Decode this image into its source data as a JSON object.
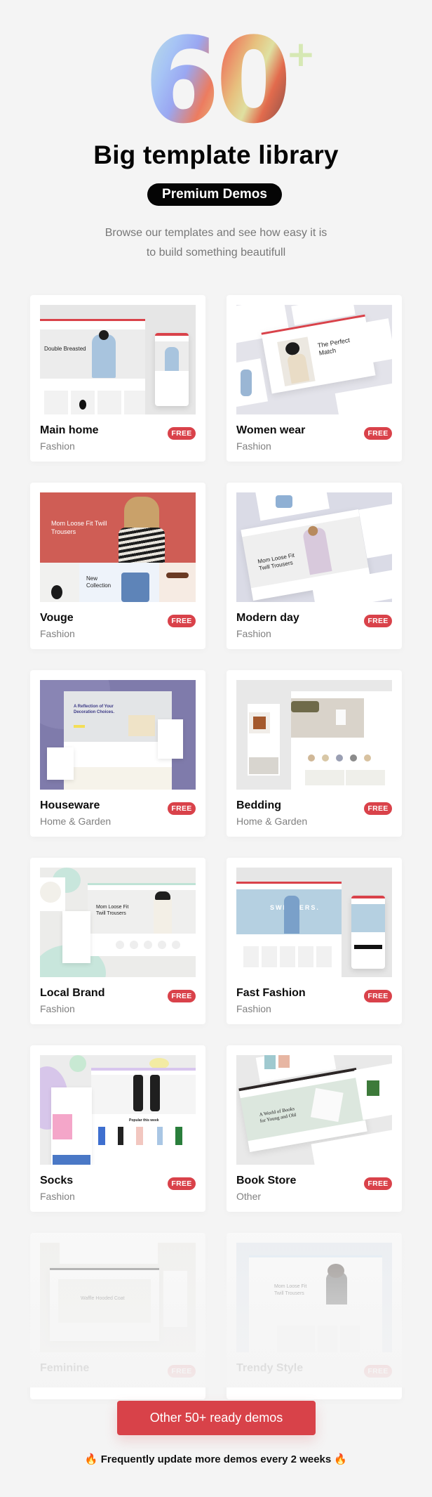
{
  "hero": {
    "number": "60",
    "plus": "+",
    "title": "Big template library",
    "pill_label": "Premium Demos",
    "subtitle_line1": "Browse our templates and see how easy it is",
    "subtitle_line2": "to build something beautifull"
  },
  "colors": {
    "background": "#f4f4f4",
    "accent_red": "#d84249",
    "badge_red": "#d9424a",
    "pill_black": "#050505"
  },
  "demos": [
    {
      "title": "Main home",
      "category": "Fashion",
      "badge": "FREE",
      "preview_text": "Double Breasted"
    },
    {
      "title": "Women wear",
      "category": "Fashion",
      "badge": "FREE",
      "preview_text": "The Perfect Match"
    },
    {
      "title": "Vouge",
      "category": "Fashion",
      "badge": "FREE",
      "preview_text": "Mom Loose Fit Twill Trousers"
    },
    {
      "title": "Modern day",
      "category": "Fashion",
      "badge": "FREE",
      "preview_text": "Mom Loose Fit Twill Trousers"
    },
    {
      "title": "Houseware",
      "category": "Home & Garden",
      "badge": "FREE",
      "preview_text": "A Reflection of Your Decoration Choices."
    },
    {
      "title": "Bedding",
      "category": "Home & Garden",
      "badge": "FREE",
      "preview_text": ""
    },
    {
      "title": "Local Brand",
      "category": "Fashion",
      "badge": "FREE",
      "preview_text": "Mom Loose Fit Twill Trousers"
    },
    {
      "title": "Fast Fashion",
      "category": "Fashion",
      "badge": "FREE",
      "preview_text": "SWEATERS."
    },
    {
      "title": "Socks",
      "category": "Fashion",
      "badge": "FREE",
      "preview_text": "Popular this week"
    },
    {
      "title": "Book Store",
      "category": "Other",
      "badge": "FREE",
      "preview_text": "A World of Books for Young and Old"
    },
    {
      "title": "Feminine",
      "category": "",
      "badge": "FREE",
      "preview_text": "Waffle Hooded Coat"
    },
    {
      "title": "Trendy Style",
      "category": "",
      "badge": "FREE",
      "preview_text": "Mom Loose Fit Twill Trousers"
    }
  ],
  "cta": {
    "label": "Other 50+ ready demos"
  },
  "footer_note": {
    "icon_left": "fire-icon",
    "text": "Frequently update more demos every 2 weeks",
    "icon_right": "fire-icon",
    "emoji": "🔥"
  }
}
